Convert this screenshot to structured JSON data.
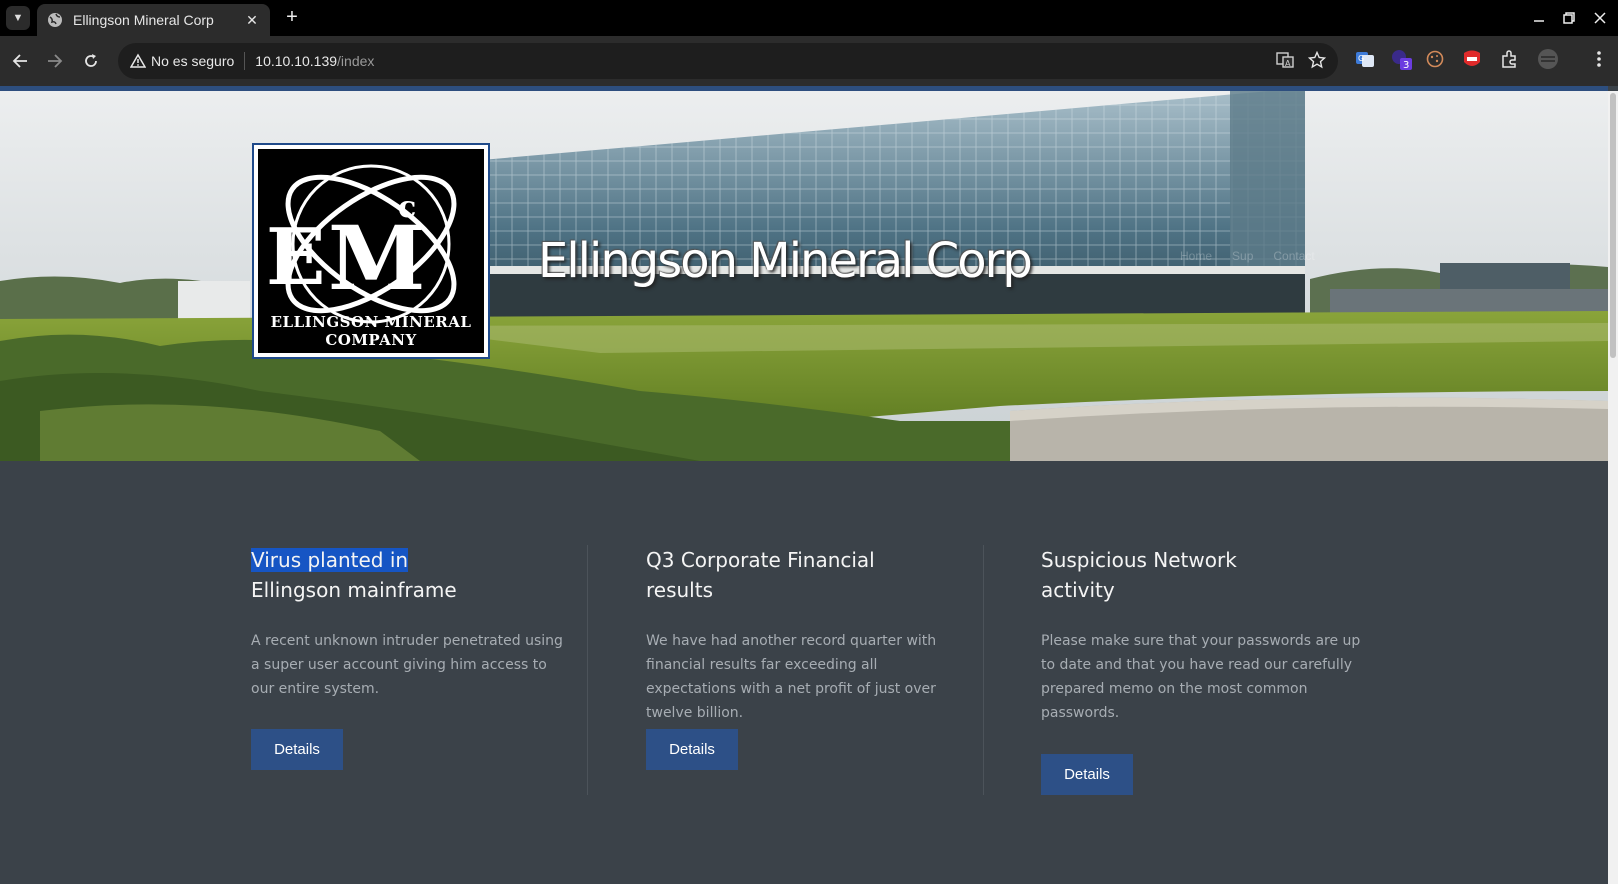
{
  "browser": {
    "tab_title": "Ellingson Mineral Corp",
    "security_label": "No es seguro",
    "url_host": "10.10.10.139",
    "url_path": "/index",
    "extension_badge": "3"
  },
  "site": {
    "logo_caption": "ELLINGSON MINERAL COMPANY",
    "logo_letters": {
      "e": "E",
      "m": "M",
      "c": "c"
    },
    "title": "Ellingson Mineral Corp",
    "nav": [
      "Home",
      "Sup",
      "Contact"
    ]
  },
  "cards": [
    {
      "title_line1": "Virus planted in",
      "title_line2": "Ellingson mainframe",
      "body": "A recent unknown intruder penetrated using a super user account giving him access to our entire system.",
      "button": "Details"
    },
    {
      "title_line1": "Q3 Corporate Financial",
      "title_line2": "results",
      "body": "We have had another record quarter with financial results far exceeding all expectations with a net profit of just over twelve billion.",
      "button": "Details"
    },
    {
      "title_line1": "Suspicious Network",
      "title_line2": "activity",
      "body": "Please make sure that your passwords are up to date and that you have read our carefully prepared memo on the most common passwords.",
      "button": "Details"
    }
  ],
  "colors": {
    "page_background": "#3b4249",
    "button": "#2d5087",
    "selection_highlight": "#1655c4",
    "top_accent_line": "#2d4e7e"
  }
}
